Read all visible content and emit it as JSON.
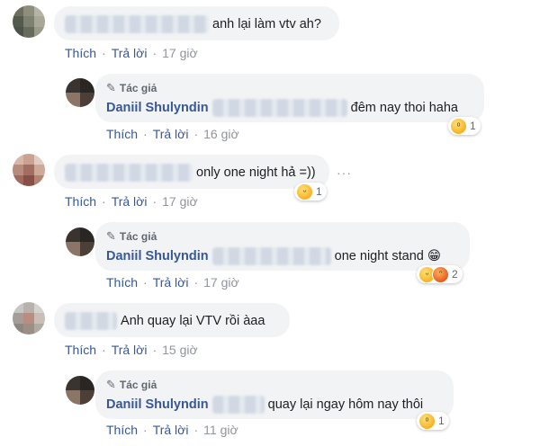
{
  "actions": {
    "like": "Thích",
    "reply": "Trả lời",
    "separator": "·"
  },
  "more_label": "···",
  "comments": [
    {
      "text": "anh lại làm vtv ah?",
      "time": "17 giờ"
    },
    {
      "author_badge": "Tác giả",
      "name": "Daniil Shulyndin",
      "text": "đêm nay thoi haha",
      "time": "16 giờ",
      "reaction_count": "1",
      "reactions": [
        "wow-icon"
      ]
    },
    {
      "text": "only one night hả =))",
      "time": "17 giờ",
      "reaction_count": "1",
      "reactions": [
        "haha-icon"
      ]
    },
    {
      "author_badge": "Tác giả",
      "name": "Daniil Shulyndin",
      "text": "one night stand 😁",
      "time": "17 giờ",
      "reaction_count": "2",
      "reactions": [
        "haha-icon",
        "angry-icon"
      ]
    },
    {
      "text": "Anh quay lại VTV rồi àaa",
      "time": "15 giờ"
    },
    {
      "author_badge": "Tác giả",
      "name": "Daniil Shulyndin",
      "text": "quay lại ngay hôm nay thôi",
      "time": "11 giờ",
      "reaction_count": "1",
      "reactions": [
        "wow-icon"
      ]
    }
  ]
}
